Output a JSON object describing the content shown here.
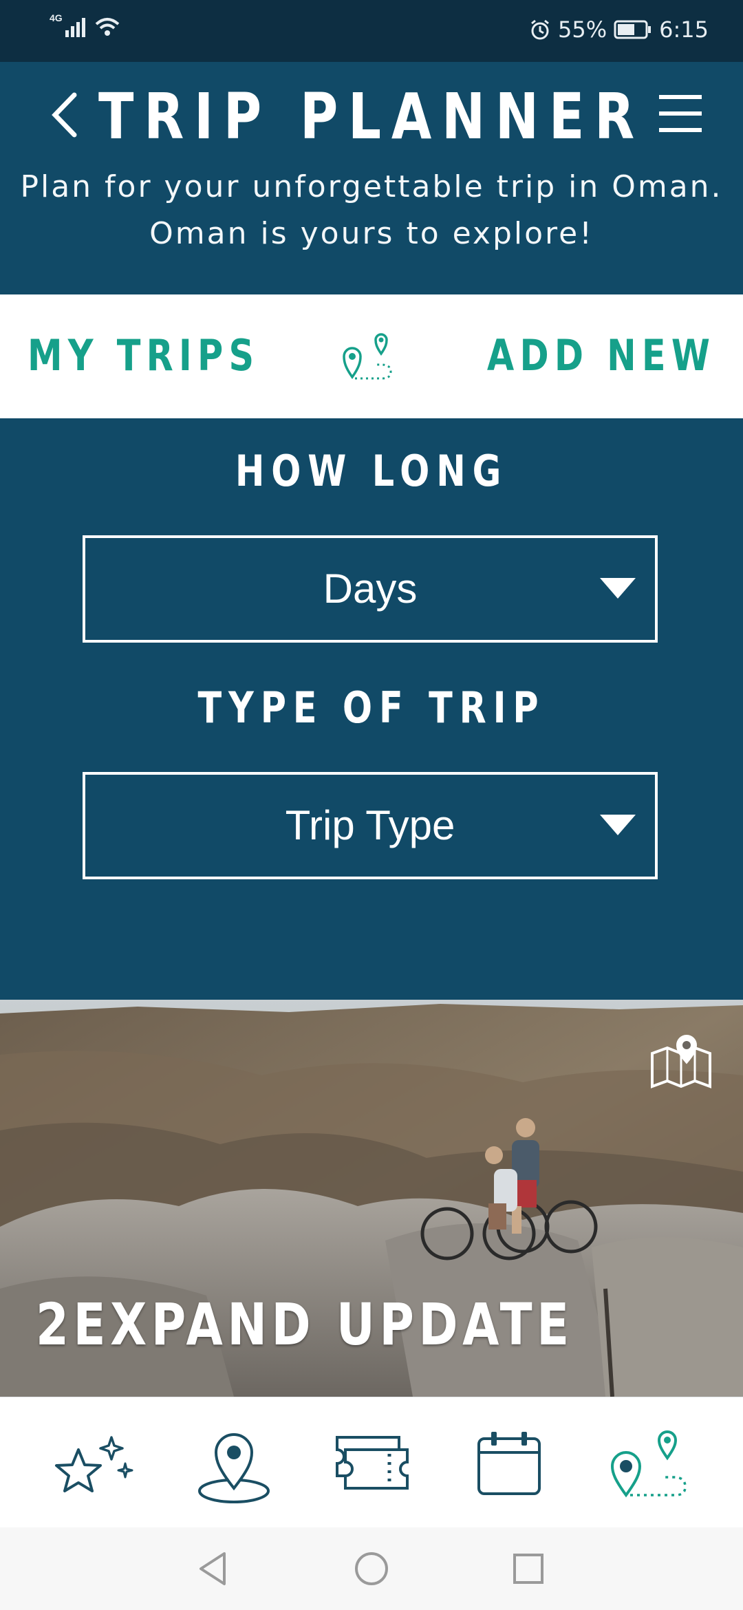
{
  "status_bar": {
    "network": "4G",
    "battery_percent": "55%",
    "time": "6:15"
  },
  "header": {
    "title": "TRIP PLANNER",
    "tagline_line1": "Plan for your unforgettable trip in Oman.",
    "tagline_line2": "Oman is yours to explore!"
  },
  "tabs": {
    "my_trips": "MY TRIPS",
    "add_new": "ADD NEW"
  },
  "form": {
    "how_long_label": "HOW LONG",
    "days_value": "Days",
    "type_label": "TYPE OF TRIP",
    "trip_type_value": "Trip Type"
  },
  "featured": {
    "title": "2EXPAND UPDATE"
  },
  "colors": {
    "header_bg": "#114a67",
    "status_bg": "#0d2e42",
    "accent_teal": "#16a08a",
    "nav_icon": "#1a4e63"
  },
  "bottom_nav": {
    "items": [
      "star-sparkle-icon",
      "location-pin-icon",
      "ticket-icon",
      "calendar-icon",
      "route-icon"
    ],
    "active": "route-icon"
  }
}
